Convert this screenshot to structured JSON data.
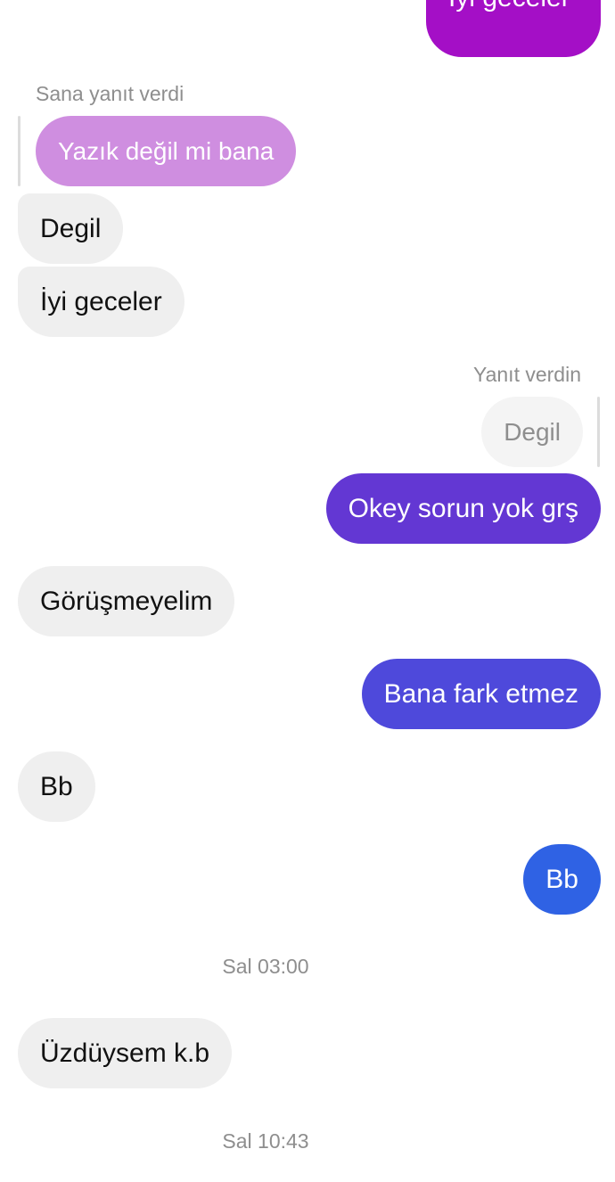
{
  "colors": {
    "incoming_bg": "#efefef",
    "outgoing_top": "#a40fc6",
    "reply_quote_bg": "#cf8ee0",
    "outgoing_1": "#6337d3",
    "outgoing_2": "#4e49db",
    "outgoing_3": "#2f62e4",
    "meta_text": "#8e8e8e"
  },
  "messages": {
    "top_out": "İyi geceler",
    "reply_label_them": "Sana yanıt verdi",
    "quoted_them": "Yazık değil mi bana",
    "in_degil": "Degil",
    "in_iyi_geceler": "İyi geceler",
    "reply_label_me": "Yanıt verdin",
    "quoted_me": "Degil",
    "out_okey": "Okey sorun yok grş",
    "in_gorusmeyelim": "Görüşmeyelim",
    "out_bana_fark": "Bana fark etmez",
    "in_bb": "Bb",
    "out_bb": "Bb",
    "time_1": "Sal 03:00",
    "in_uzduysem": "Üzdüysem k.b",
    "time_2": "Sal 10:43"
  }
}
